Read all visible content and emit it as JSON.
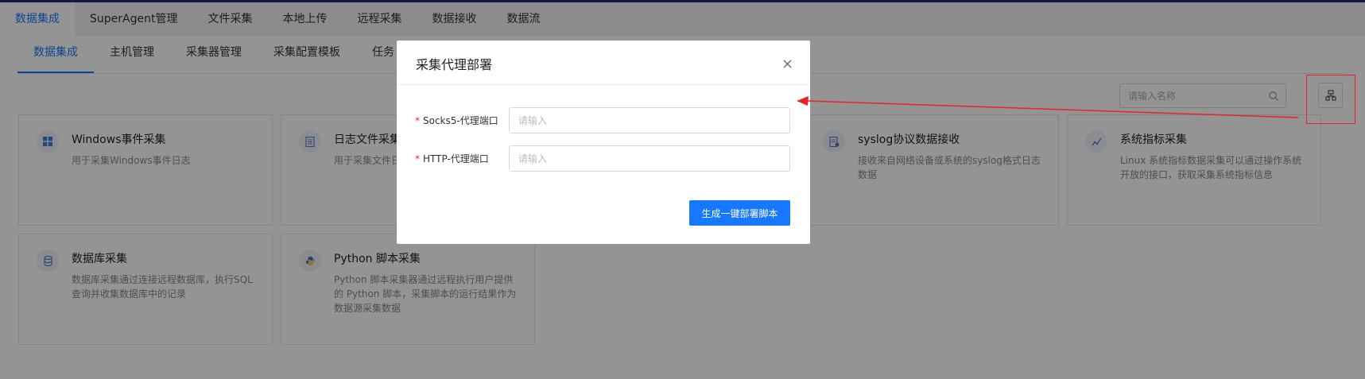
{
  "top_tabs": [
    "数据集成",
    "SuperAgent管理",
    "文件采集",
    "本地上传",
    "远程采集",
    "数据接收",
    "数据流"
  ],
  "sub_tabs": [
    "数据集成",
    "主机管理",
    "采集器管理",
    "采集配置模板",
    "任务"
  ],
  "search": {
    "placeholder": "请输入名称",
    "icon": "search-icon"
  },
  "deploy_button_icon": "deploy-icon",
  "cards": [
    {
      "title": "Windows事件采集",
      "desc": "用于采集Windows事件日志",
      "icon": "windows-icon"
    },
    {
      "title": "日志文件采集",
      "desc": "用于采集文件日志",
      "icon": "file-icon"
    },
    {
      "title": "syslog协议数据接收",
      "desc": "接收来自网络设备或系统的syslog格式日志数据",
      "icon": "syslog-icon"
    },
    {
      "title": "系统指标采集",
      "desc": "Linux 系统指标数据采集可以通过操作系统开放的接口，获取采集系统指标信息",
      "icon": "metrics-icon"
    },
    {
      "title": "数据库采集",
      "desc": "数据库采集通过连接远程数据库，执行SQL查询并收集数据库中的记录",
      "icon": "database-icon"
    },
    {
      "title": "Python 脚本采集",
      "desc": "Python 脚本采集器通过远程执行用户提供的 Python 脚本，采集脚本的运行结果作为数据源采集数据",
      "icon": "python-icon"
    }
  ],
  "modal": {
    "title": "采集代理部署",
    "fields": [
      {
        "label": "Socks5-代理端口",
        "required": true,
        "placeholder": "请输入",
        "value": ""
      },
      {
        "label": "HTTP-代理端口",
        "required": true,
        "placeholder": "请输入",
        "value": ""
      }
    ],
    "submit_label": "生成一键部署脚本"
  },
  "colors": {
    "accent": "#1677ff",
    "highlight": "#e8232a",
    "required": "#f5222d"
  }
}
